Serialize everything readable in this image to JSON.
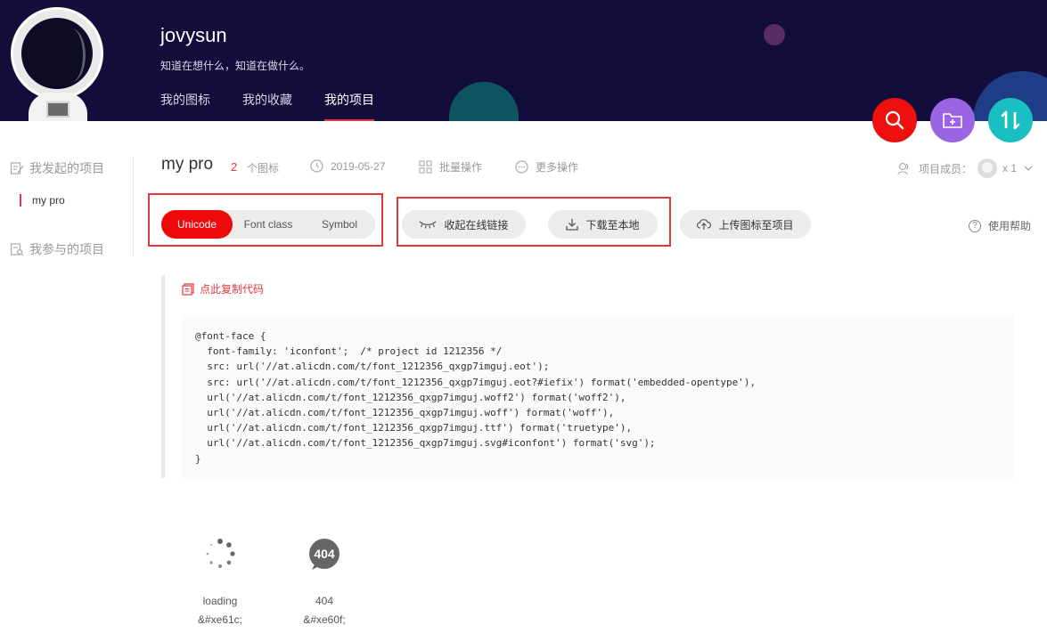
{
  "header": {
    "username": "jovysun",
    "motto": "知道在想什么，知道在做什么。",
    "tabs": [
      {
        "label": "我的图标",
        "active": false
      },
      {
        "label": "我的收藏",
        "active": false
      },
      {
        "label": "我的项目",
        "active": true
      }
    ],
    "fabs": {
      "search": "search-icon",
      "new_project": "folder-plus-icon",
      "sort": "sort-icon"
    }
  },
  "sidebar": {
    "initiated_label": "我发起的项目",
    "projects": [
      "my pro"
    ],
    "joined_label": "我参与的项目"
  },
  "project": {
    "name": "my pro",
    "icon_count": "2",
    "icon_count_label": "个图标",
    "date": "2019-05-27",
    "batch_label": "批量操作",
    "more_label": "更多操作",
    "members_label": "项目成员：",
    "members_count": "x 1"
  },
  "toolbar": {
    "formats": [
      {
        "label": "Unicode",
        "active": true
      },
      {
        "label": "Font class",
        "active": false
      },
      {
        "label": "Symbol",
        "active": false
      }
    ],
    "collapse_link_label": "收起在线链接",
    "download_label": "下载至本地",
    "upload_label": "上传图标至项目",
    "help_label": "使用帮助"
  },
  "code": {
    "copy_label": "点此复制代码",
    "text": "@font-face {\n  font-family: 'iconfont';  /* project id 1212356 */\n  src: url('//at.alicdn.com/t/font_1212356_qxgp7imguj.eot');\n  src: url('//at.alicdn.com/t/font_1212356_qxgp7imguj.eot?#iefix') format('embedded-opentype'),\n  url('//at.alicdn.com/t/font_1212356_qxgp7imguj.woff2') format('woff2'),\n  url('//at.alicdn.com/t/font_1212356_qxgp7imguj.woff') format('woff'),\n  url('//at.alicdn.com/t/font_1212356_qxgp7imguj.ttf') format('truetype'),\n  url('//at.alicdn.com/t/font_1212356_qxgp7imguj.svg#iconfont') format('svg');\n}"
  },
  "icons": [
    {
      "name": "loading",
      "code": "&#xe61c;",
      "icon": "loading-icon"
    },
    {
      "name": "404",
      "code": "&#xe60f;",
      "icon": "404-icon",
      "glyph_text": "404"
    }
  ],
  "colors": {
    "header_bg": "#120d3a",
    "accent_red": "#ee0a0a",
    "fab_purple": "#9b64e3",
    "fab_teal": "#19bfc1"
  }
}
